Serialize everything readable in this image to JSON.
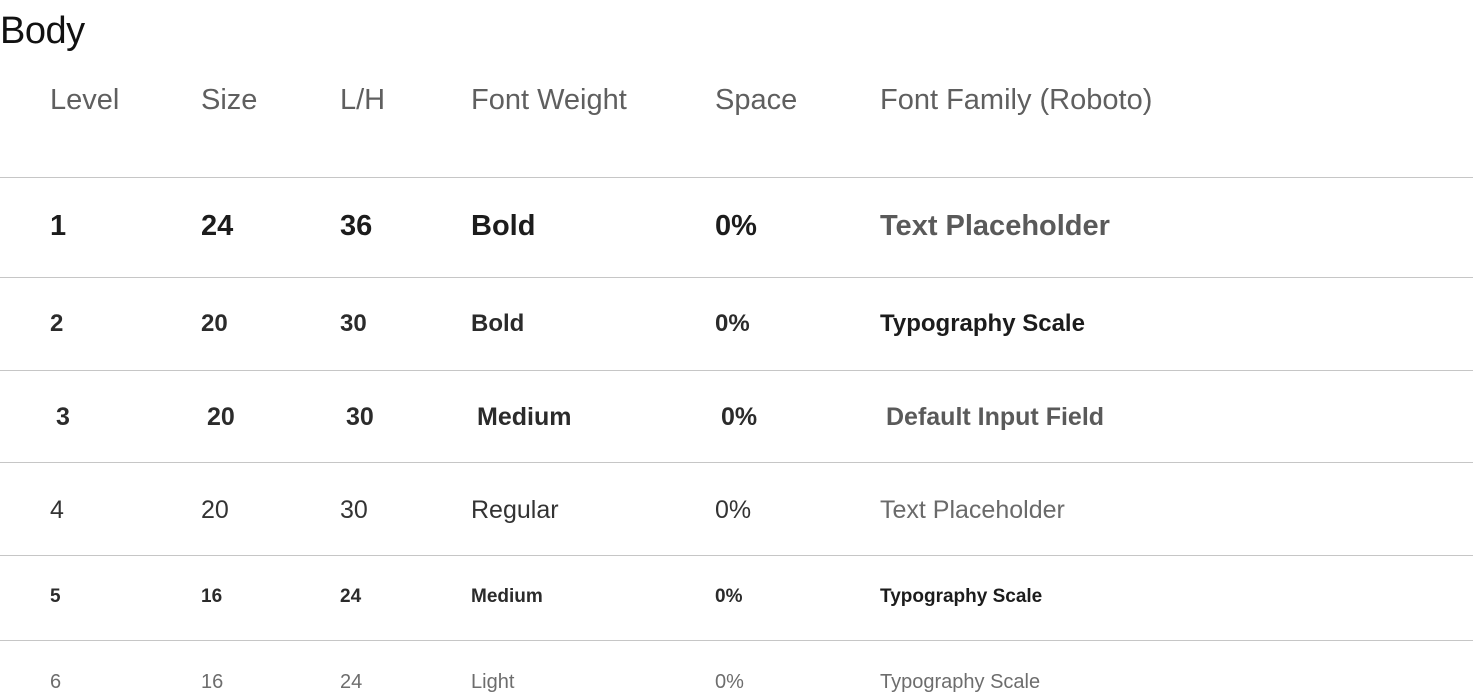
{
  "title": "Body",
  "headers": {
    "level": "Level",
    "size": "Size",
    "line_height": "L/H",
    "font_weight": "Font Weight",
    "space": "Space",
    "font_family": "Font Family (Roboto)"
  },
  "rows": [
    {
      "level": "1",
      "size": "24",
      "line_height": "36",
      "font_weight": "Bold",
      "space": "0%",
      "sample": "Text Placeholder"
    },
    {
      "level": "2",
      "size": "20",
      "line_height": "30",
      "font_weight": "Bold",
      "space": "0%",
      "sample": "Typography Scale"
    },
    {
      "level": "3",
      "size": "20",
      "line_height": "30",
      "font_weight": "Medium",
      "space": "0%",
      "sample": "Default Input Field"
    },
    {
      "level": "4",
      "size": "20",
      "line_height": "30",
      "font_weight": "Regular",
      "space": "0%",
      "sample": "Text Placeholder"
    },
    {
      "level": "5",
      "size": "16",
      "line_height": "24",
      "font_weight": "Medium",
      "space": "0%",
      "sample": "Typography Scale"
    },
    {
      "level": "6",
      "size": "16",
      "line_height": "24",
      "font_weight": "Light",
      "space": "0%",
      "sample": "Typography Scale"
    }
  ]
}
